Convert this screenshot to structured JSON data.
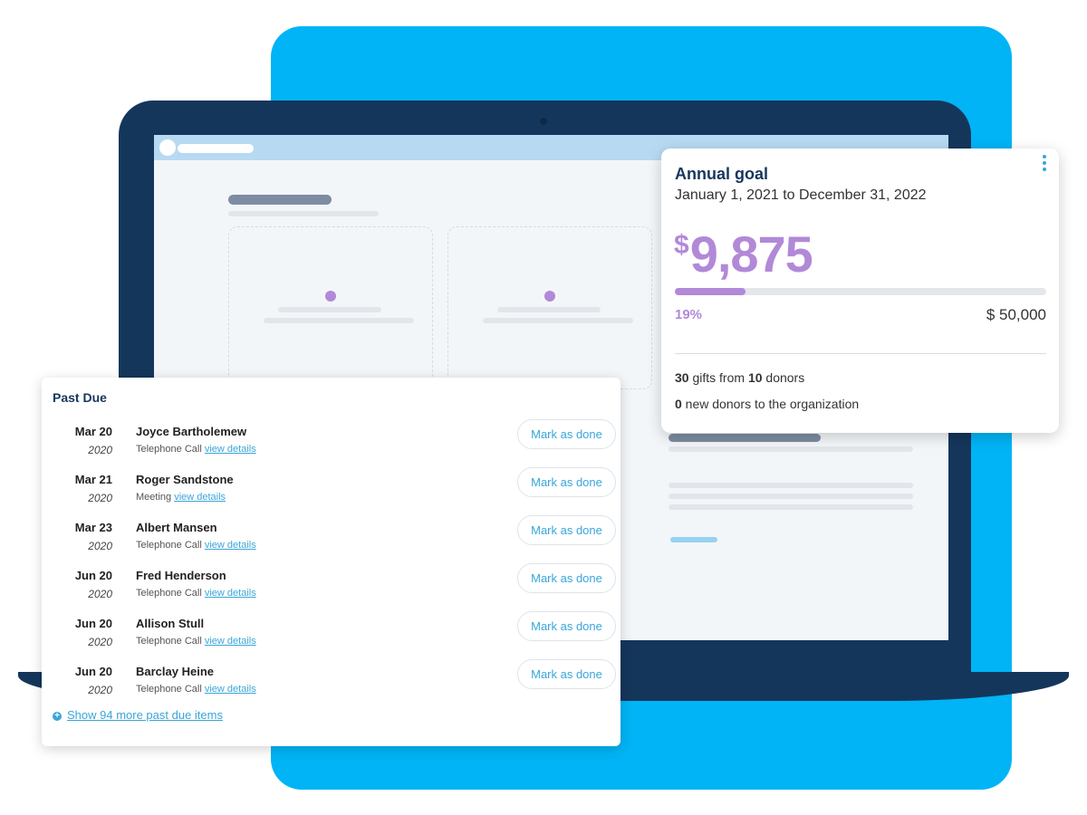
{
  "past_due": {
    "title": "Past Due",
    "mark_label": "Mark as done",
    "view_link": "view details",
    "items": [
      {
        "date": "Mar 20",
        "year": "2020",
        "name": "Joyce Bartholemew",
        "type": "Telephone Call"
      },
      {
        "date": "Mar 21",
        "year": "2020",
        "name": "Roger Sandstone",
        "type": "Meeting"
      },
      {
        "date": "Mar 23",
        "year": "2020",
        "name": "Albert Mansen",
        "type": "Telephone Call"
      },
      {
        "date": "Jun 20",
        "year": "2020",
        "name": "Fred Henderson",
        "type": "Telephone Call"
      },
      {
        "date": "Jun 20",
        "year": "2020",
        "name": "Allison Stull",
        "type": "Telephone Call"
      },
      {
        "date": "Jun 20",
        "year": "2020",
        "name": "Barclay Heine",
        "type": "Telephone Call"
      }
    ],
    "show_more": "Show 94 more past due items"
  },
  "goal": {
    "title": "Annual goal",
    "range": "January 1, 2021 to December 31, 2022",
    "currency": "$",
    "amount": "9,875",
    "progress_fraction": 0.19,
    "percent_label": "19%",
    "target": "$ 50,000",
    "gifts_count": "30",
    "gifts_text": " gifts from ",
    "donors_count": "10",
    "donors_text": " donors",
    "new_donors_count": "0",
    "new_donors_text": " new donors to the organization"
  },
  "colors": {
    "background_accent": "#00b4f5",
    "laptop": "#15365b",
    "purple": "#b189d8",
    "link_blue": "#3aa5d8",
    "navy_text": "#17365d"
  },
  "icons": {
    "more": "kebab-menu-icon",
    "show_more": "plus-circle-icon"
  }
}
